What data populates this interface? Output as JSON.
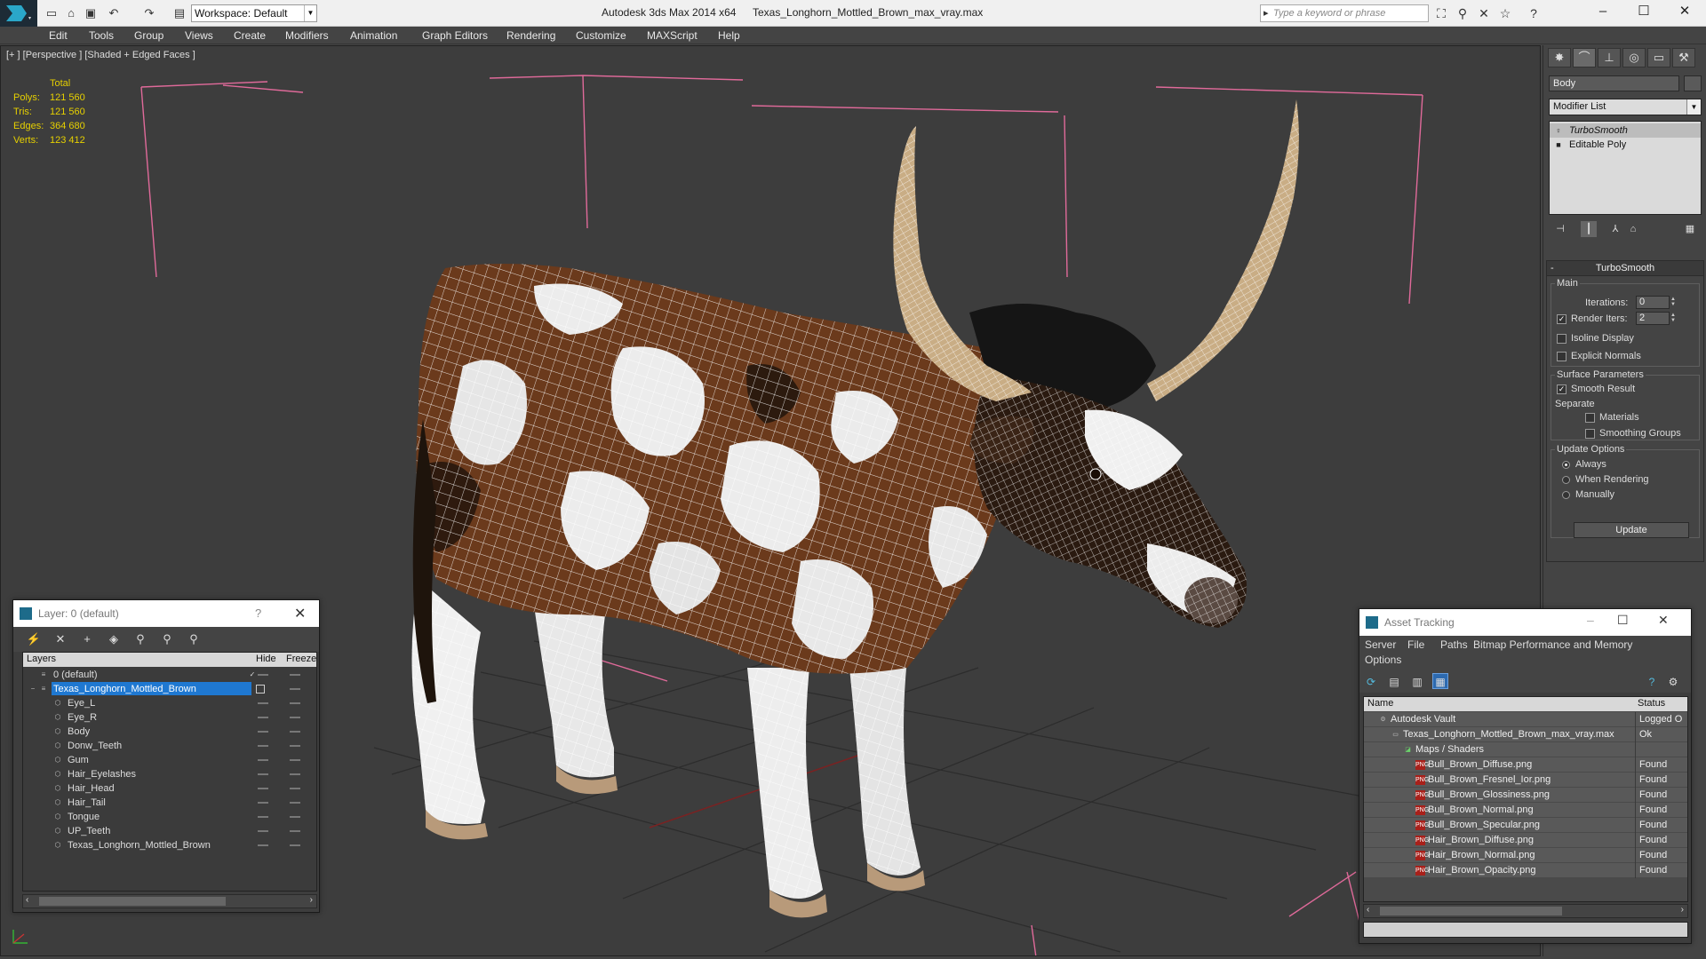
{
  "titlebar": {
    "workspace": "Workspace: Default",
    "app_title": "Autodesk 3ds Max  2014 x64",
    "file_title": "Texas_Longhorn_Mottled_Brown_max_vray.max",
    "search_placeholder": "Type a keyword or phrase",
    "window_controls": [
      "–",
      "☐",
      "✕"
    ]
  },
  "menu": [
    "Edit",
    "Tools",
    "Group",
    "Views",
    "Create",
    "Modifiers",
    "Animation",
    "Graph Editors",
    "Rendering",
    "Customize",
    "MAXScript",
    "Help"
  ],
  "viewport": {
    "label": "[+ ] [Perspective ] [Shaded + Edged Faces ]",
    "stats": {
      "header": "Total",
      "rows": [
        {
          "label": "Polys:",
          "value": "121 560"
        },
        {
          "label": "Tris:",
          "value": "121 560"
        },
        {
          "label": "Edges:",
          "value": "364 680"
        },
        {
          "label": "Verts:",
          "value": "123 412"
        }
      ]
    },
    "colors": {
      "stats": "#e6d000",
      "bbox": "#e06a9a",
      "hide_brown": "#6b3a1c",
      "hide_white": "#ececec",
      "horn": "#c9ad85"
    }
  },
  "command_panel": {
    "object_name": "Body",
    "modifier_list": "Modifier List",
    "stack": [
      "TurboSmooth",
      "Editable Poly"
    ],
    "rollout": {
      "title": "TurboSmooth",
      "main_label": "Main",
      "iterations_label": "Iterations:",
      "iterations_value": "0",
      "render_iters_label": "Render Iters:",
      "render_iters_value": "2",
      "isoline": "Isoline Display",
      "explicit_normals": "Explicit Normals",
      "surface_params": "Surface Parameters",
      "smooth_result": "Smooth Result",
      "separate": "Separate",
      "materials": "Materials",
      "smoothing_groups": "Smoothing Groups",
      "update_options": "Update Options",
      "always": "Always",
      "when_rendering": "When Rendering",
      "manually": "Manually",
      "update_button": "Update"
    }
  },
  "layer_window": {
    "title": "Layer: 0 (default)",
    "help": "?",
    "close": "✕",
    "columns": [
      "Layers",
      "Hide",
      "Freeze"
    ],
    "rows": [
      "0 (default)",
      "Texas_Longhorn_Mottled_Brown",
      "Eye_L",
      "Eye_R",
      "Body",
      "Donw_Teeth",
      "Gum",
      "Hair_Eyelashes",
      "Hair_Head",
      "Hair_Tail",
      "Tongue",
      "UP_Teeth",
      "Texas_Longhorn_Mottled_Brown"
    ]
  },
  "asset_window": {
    "title": "Asset Tracking",
    "menu": [
      "Server",
      "File",
      "Paths",
      "Bitmap Performance and Memory",
      "Options"
    ],
    "columns": [
      "Name",
      "Status"
    ],
    "rows": [
      {
        "name": "Autodesk Vault",
        "status": "Logged O"
      },
      {
        "name": "Texas_Longhorn_Mottled_Brown_max_vray.max",
        "status": "Ok"
      },
      {
        "name": "Maps / Shaders",
        "status": ""
      },
      {
        "name": "Bull_Brown_Diffuse.png",
        "status": "Found"
      },
      {
        "name": "Bull_Brown_Fresnel_Ior.png",
        "status": "Found"
      },
      {
        "name": "Bull_Brown_Glossiness.png",
        "status": "Found"
      },
      {
        "name": "Bull_Brown_Normal.png",
        "status": "Found"
      },
      {
        "name": "Bull_Brown_Specular.png",
        "status": "Found"
      },
      {
        "name": "Hair_Brown_Diffuse.png",
        "status": "Found"
      },
      {
        "name": "Hair_Brown_Normal.png",
        "status": "Found"
      },
      {
        "name": "Hair_Brown_Opacity.png",
        "status": "Found"
      }
    ]
  }
}
